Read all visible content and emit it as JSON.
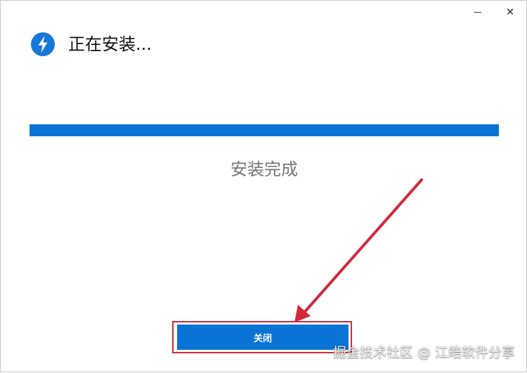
{
  "window": {
    "title": "正在安装...",
    "icon": "lightning-bolt-icon",
    "minimize_glyph": "—",
    "close_glyph": "✕"
  },
  "progress": {
    "fraction": 1.0,
    "status_text": "安装完成"
  },
  "actions": {
    "close_label": "关闭"
  },
  "annotation": {
    "arrow_color": "#d22a3a",
    "highlight_color": "#d22a3a"
  },
  "watermark": {
    "text": "掘金技术社区 @ 江皓软件分享"
  },
  "colors": {
    "accent": "#0a74d6",
    "status_text": "#777777"
  }
}
